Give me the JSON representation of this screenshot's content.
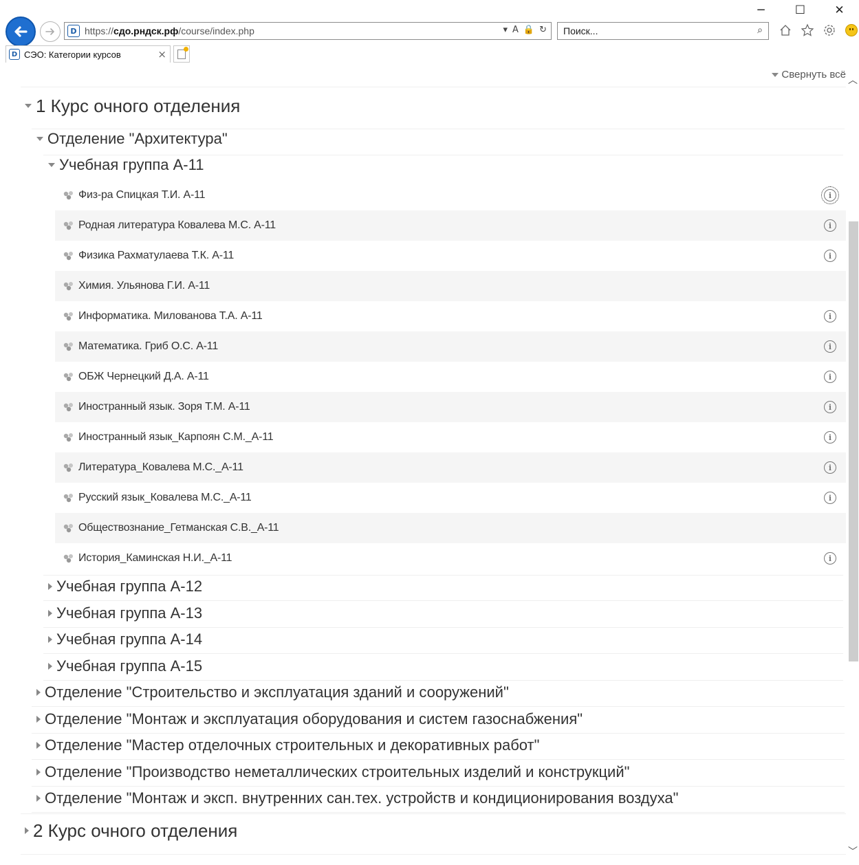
{
  "browser": {
    "window_controls": {
      "minimize": "─",
      "maximize": "☐",
      "close": "✕"
    },
    "back_icon": "back-arrow",
    "forward_icon": "forward-arrow",
    "address": {
      "proto": "https://",
      "host": "сдо.рндск.рф",
      "path": "/course/index.php"
    },
    "address_icons": [
      "▾",
      "A",
      "🔒",
      "↻"
    ],
    "search_placeholder": "Поиск...",
    "search_icon": "⌕",
    "toolbar_icons": [
      "home-icon",
      "favorites-star-icon",
      "settings-gear-icon",
      "smiley-feedback-icon"
    ],
    "tab": {
      "title": "СЭО: Категории курсов",
      "close": "×"
    },
    "favicon_letter": "D"
  },
  "page": {
    "collapse_all": "Свернуть всё",
    "category1": {
      "title": "1 Курс очного отделения",
      "department_arch": {
        "title": "Отделение \"Архитектура\"",
        "group_a11": {
          "title": "Учебная группа А-11",
          "courses": [
            {
              "name": "Физ-ра Спицкая Т.И. А-11",
              "has_info": true
            },
            {
              "name": "Родная литература Ковалева М.С. А-11",
              "has_info": true
            },
            {
              "name": "Физика Рахматулаева Т.К. А-11",
              "has_info": true
            },
            {
              "name": "Химия. Ульянова Г.И. А-11",
              "has_info": false
            },
            {
              "name": "Информатика. Милованова Т.А. А-11",
              "has_info": true
            },
            {
              "name": "Математика. Гриб О.С. А-11",
              "has_info": true
            },
            {
              "name": "ОБЖ Чернецкий Д.А. А-11",
              "has_info": true
            },
            {
              "name": "Иностранный язык. Зоря Т.М. А-11",
              "has_info": true
            },
            {
              "name": "Иностранный язык_Карпоян С.М._А-11",
              "has_info": true
            },
            {
              "name": "Литература_Ковалева М.С._А-11",
              "has_info": true
            },
            {
              "name": "Русский язык_Ковалева М.С._А-11",
              "has_info": true
            },
            {
              "name": "Обществознание_Гетманская С.В._А-11",
              "has_info": false
            },
            {
              "name": "История_Каминская Н.И._А-11",
              "has_info": true
            }
          ]
        },
        "collapsed_groups": [
          "Учебная группа А-12",
          "Учебная группа А-13",
          "Учебная группа А-14",
          "Учебная группа А-15"
        ]
      },
      "collapsed_departments": [
        "Отделение \"Строительство и эксплуатация зданий и сооружений\"",
        "Отделение \"Монтаж и эксплуатация оборудования и систем газоснабжения\"",
        "Отделение \"Мастер отделочных строительных и декоративных работ\"",
        "Отделение \"Производство неметаллических строительных изделий и конструкций\"",
        "Отделение \"Монтаж и эксп. внутренних сан.тех. устройств и кондиционирования воздуха\""
      ]
    },
    "category2": {
      "title": "2 Курс очного отделения"
    },
    "info_glyph": "i"
  },
  "colors": {
    "accent": "#1f6fd0",
    "row_shade": "#f5f5f5",
    "text": "#333333",
    "muted": "#888888"
  }
}
